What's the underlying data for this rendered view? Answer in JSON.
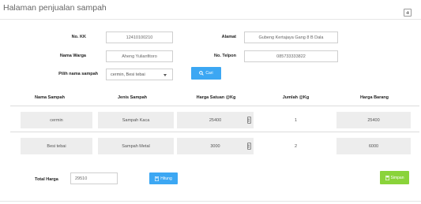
{
  "page": {
    "title": "Halaman penjualan sampah"
  },
  "form": {
    "no_kk": {
      "label": "No. KK",
      "value": "12410100210"
    },
    "nama_warga": {
      "label": "Nama Warga",
      "value": "Aheng Yulianfitoro"
    },
    "pilih_sampah": {
      "label": "Pilih nama sampah",
      "value": "cermin, Besi tebai"
    },
    "alamat": {
      "label": "Alamat",
      "value": "Gubeng Kertajaya Gang 8 B Dala"
    },
    "no_telpon": {
      "label": "No. Telpon",
      "value": "085733333822"
    },
    "cari_label": "Cari"
  },
  "table": {
    "headers": [
      "Nama Sampah",
      "Jenis Sampah",
      "Harga Satuan @Kg",
      "Jumlah @Kg",
      "Harga Barang"
    ],
    "rows": [
      {
        "nama": "cermin",
        "jenis": "Sampah Kaca",
        "harga_satuan": "25400",
        "jumlah": "1",
        "harga_barang": "25400"
      },
      {
        "nama": "Besi tebai",
        "jenis": "Sampah Metal",
        "harga_satuan": "3000",
        "jumlah": "2",
        "harga_barang": "6000"
      }
    ]
  },
  "footer": {
    "total_label": "Total Harga",
    "total_value": "29510",
    "hitung_label": "Hitung",
    "simpan_label": "Simpan"
  },
  "colors": {
    "primary": "#3ca7f3",
    "success": "#8ad33a"
  },
  "icons": {
    "expand": "expand-icon",
    "search": "search-icon",
    "calculator": "calculator-icon",
    "save": "save-icon"
  }
}
